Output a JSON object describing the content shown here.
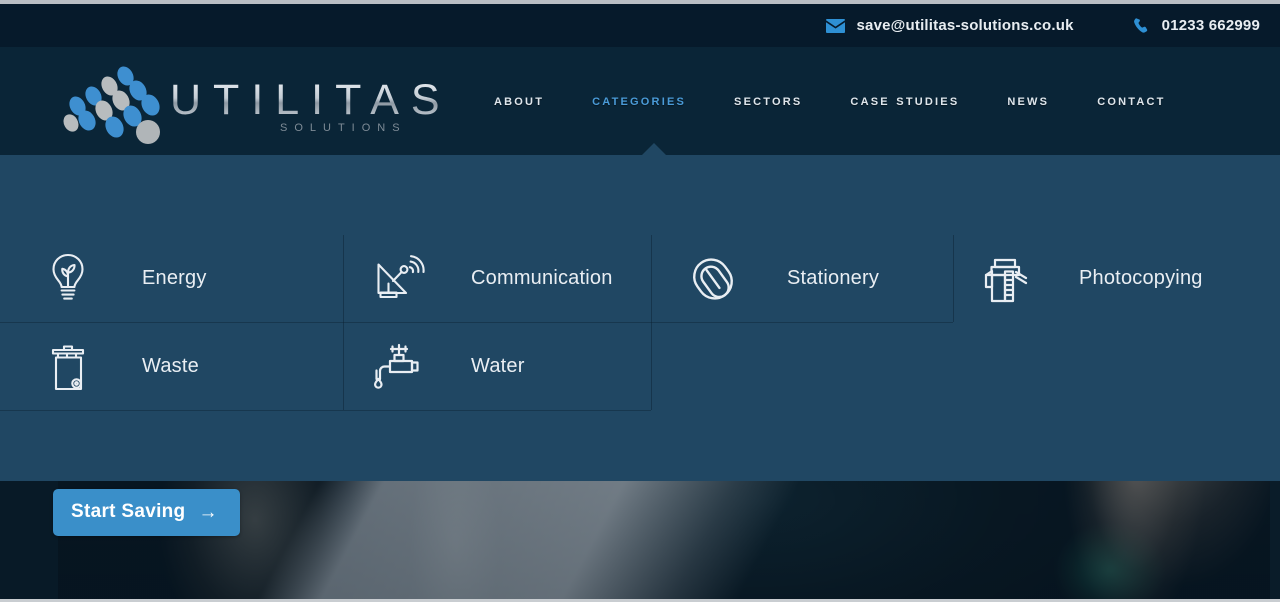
{
  "topbar": {
    "email": "save@utilitas-solutions.co.uk",
    "phone": "01233 662999",
    "email_icon": "envelope-icon",
    "phone_icon": "phone-icon"
  },
  "brand": {
    "name": "UTILITAS",
    "tagline": "SOLUTIONS",
    "logo_icon": "utilitas-dots-logo"
  },
  "nav": {
    "items": [
      {
        "label": "About",
        "active": false
      },
      {
        "label": "Categories",
        "active": true
      },
      {
        "label": "Sectors",
        "active": false
      },
      {
        "label": "Case Studies",
        "active": false
      },
      {
        "label": "News",
        "active": false
      },
      {
        "label": "Contact",
        "active": false
      }
    ]
  },
  "dropdown": {
    "row1": [
      {
        "label": "Energy",
        "icon": "lightbulb-leaf-icon"
      },
      {
        "label": "Communication",
        "icon": "satellite-dish-icon"
      },
      {
        "label": "Stationery",
        "icon": "paperclip-icon"
      },
      {
        "label": "Photocopying",
        "icon": "photocopier-icon"
      }
    ],
    "row2": [
      {
        "label": "Waste",
        "icon": "wheelie-bin-icon"
      },
      {
        "label": "Water",
        "icon": "tap-faucet-icon"
      }
    ]
  },
  "cta": {
    "label": "Start Saving",
    "arrow": "→",
    "icon": "arrow-right-icon"
  },
  "colors": {
    "topbar_bg": "#061a2b",
    "header_bg": "#0a2537",
    "dropdown_bg": "#204763",
    "accent_blue": "#2e90d4",
    "active_nav": "#4a9bd8",
    "cta_bg": "#3a8fc9",
    "text_light": "#e9eef3"
  }
}
